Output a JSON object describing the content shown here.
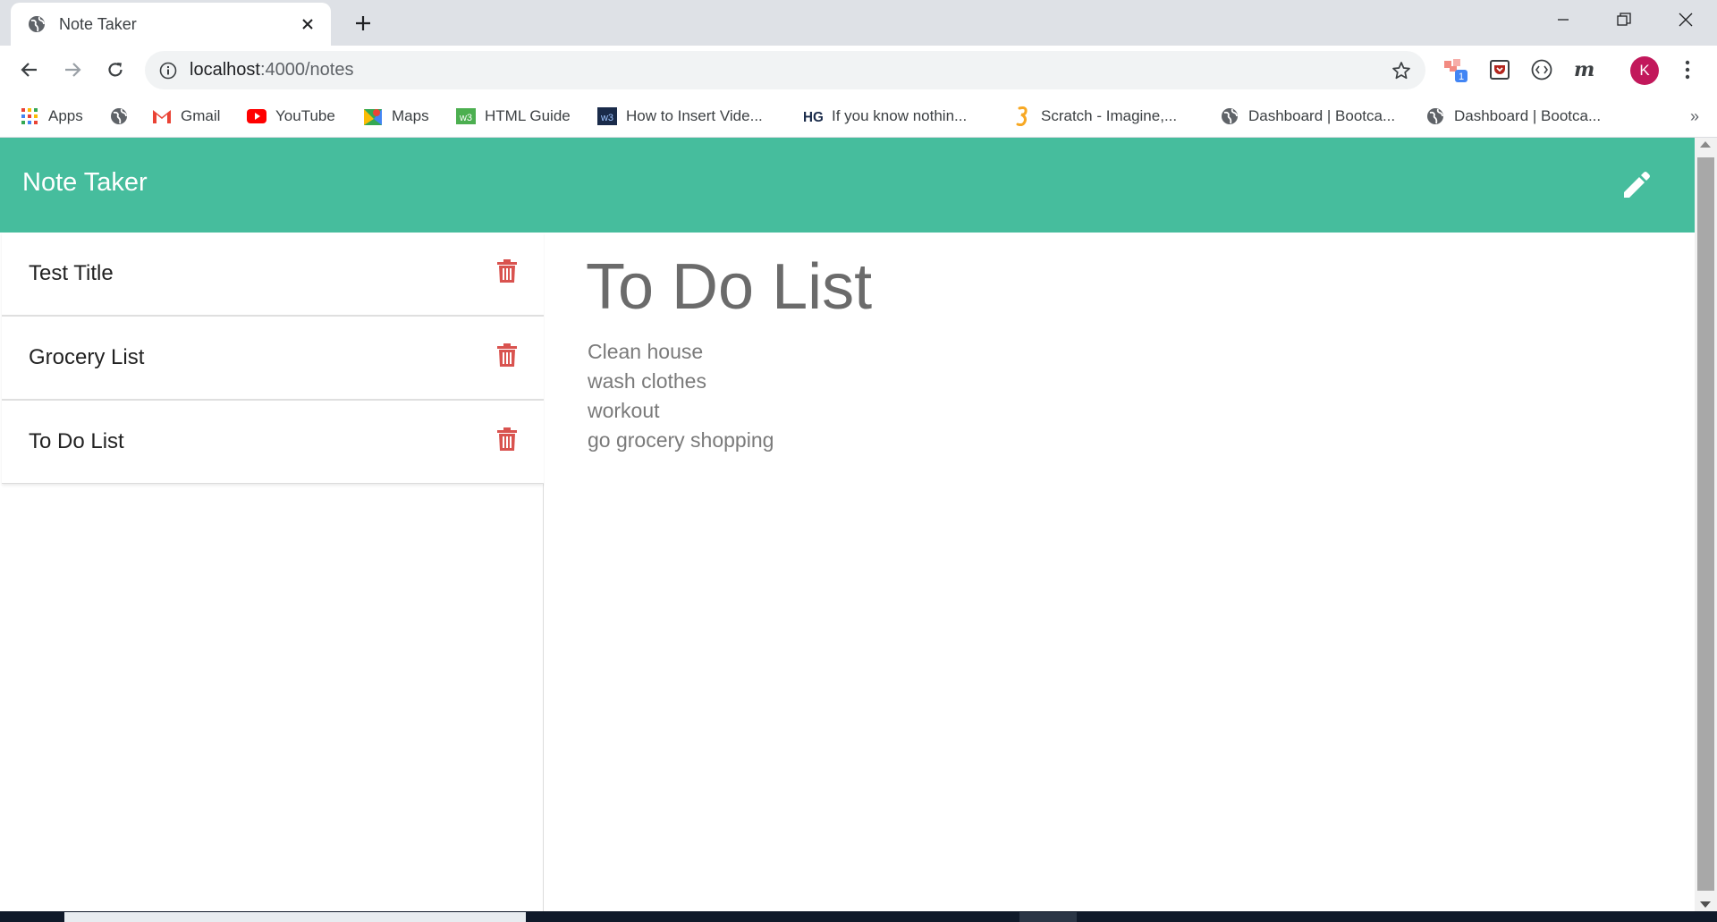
{
  "browser": {
    "tab_title": "Note Taker",
    "url_host": "localhost",
    "url_path": ":4000/notes",
    "profile_initial": "K",
    "bookmarks": [
      {
        "label": "Apps",
        "icon": "apps-grid-icon"
      },
      {
        "label": "",
        "icon": "globe-icon"
      },
      {
        "label": "Gmail",
        "icon": "gmail-icon"
      },
      {
        "label": "YouTube",
        "icon": "youtube-icon"
      },
      {
        "label": "Maps",
        "icon": "maps-icon"
      },
      {
        "label": "HTML Guide",
        "icon": "w3-icon"
      },
      {
        "label": "How to Insert Vide...",
        "icon": "w3-dark-icon"
      },
      {
        "label": "If you know nothin...",
        "icon": "hg-icon"
      },
      {
        "label": "Scratch - Imagine,...",
        "icon": "scratch-icon"
      },
      {
        "label": "Dashboard | Bootca...",
        "icon": "globe-icon"
      },
      {
        "label": "Dashboard | Bootca...",
        "icon": "globe-icon"
      }
    ],
    "bookmarks_more": "»",
    "extensions": [
      "extension-badge-icon",
      "pocket-icon",
      "code-icon",
      "m-icon"
    ],
    "extension_badge": "1"
  },
  "app": {
    "brand": "Note Taker",
    "accent": "#46bd9d",
    "trash_color": "#d9534f",
    "notes": [
      {
        "title": "Test Title"
      },
      {
        "title": "Grocery List"
      },
      {
        "title": "To Do List"
      }
    ],
    "active_note": {
      "title": "To Do List",
      "lines": [
        "Clean house",
        "wash clothes",
        "workout",
        "go grocery shopping"
      ]
    }
  }
}
